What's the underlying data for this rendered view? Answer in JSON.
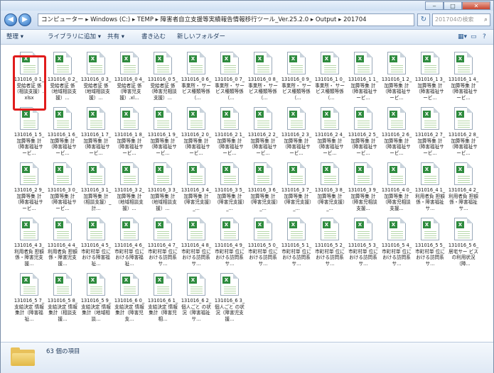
{
  "address": {
    "path": "コンピューター ▸ Windows (C:) ▸ TEMP ▸ 障害者自立支援等実績報告情報移行ツール_Ver.25.2.0 ▸ Output ▸ 201704",
    "search_placeholder": "201704の検索"
  },
  "toolbar": {
    "organize": "整理 ▾",
    "library": "ライブラリに追加 ▾",
    "share": "共有 ▾",
    "burn": "書き込む",
    "new_folder": "新しいフォルダー"
  },
  "files": [
    "131016_0 1_受給者証 係（相談支援）.xlsx",
    "131016_0 2_受給者証 係（地域相談支援）...",
    "131016_0 3_受給者証 係（地域相談支援）...",
    "131016_0 4_受給者証 係（障害児支援）.xl...",
    "131016_0 5_受給者証 係（障害児相談支援）...",
    "131016_0 6_事業所・ サービス種類等係（...",
    "131016_0 7_事業所・ サービス種類等係（...",
    "131016_0 8_事業所・ サービス種類等係（...",
    "131016_0 9_事業所・ サービス種類等係（...",
    "131016_1 0_事業所・ サービス種類等係（...",
    "131016_1 1_加算等集 計（障害福祉サービ...",
    "131016_1 2_加算等集 計（障害福祉サービ...",
    "131016_1 3_加算等集 計（障害福祉サービ...",
    "131016_1 4_加算等集 計（障害福祉サービ...",
    "131016_1 5_加算等集 計（障害福祉サービ...",
    "131016_1 6_加算等集 計（障害福祉サービ...",
    "131016_1 7_加算等集 計（障害福祉サービ...",
    "131016_1 8_加算等集 計（障害福祉サービ...",
    "131016_1 9_加算等集 計（障害福祉サービ...",
    "131016_2 0_加算等集 計（障害福祉サービ...",
    "131016_2 1_加算等集 計（障害福祉サービ...",
    "131016_2 2_加算等集 計（障害福祉サービ...",
    "131016_2 3_加算等集 計（障害福祉サービ...",
    "131016_2 4_加算等集 計（障害福祉サービ...",
    "131016_2 5_加算等集 計（障害福祉サービ...",
    "131016_2 6_加算等集 計（障害福祉サービ...",
    "131016_2 7_加算等集 計（障害福祉サービ...",
    "131016_2 8_加算等集 計（障害福祉サービ...",
    "131016_2 9_加算等集 計（障害福祉サービ...",
    "131016_3 0_加算等集 計（障害福祉サービ...",
    "131016_3 1_加算等集 計（相談支援）_計...",
    "131016_3 2_加算等集 計（地域相談支援）...",
    "131016_3 3_加算等集 計（地域相談支援）...",
    "131016_3 4_加算等集 計（障害児支援）_...",
    "131016_3 5_加算等集 計（障害児支援）_...",
    "131016_3 6_加算等集 計（障害児支援）_...",
    "131016_3 7_加算等集 計（障害児支援）_...",
    "131016_3 8_加算等集 計（障害児支援）_...",
    "131016_3 9_加算等集 計（障害児相談支援...",
    "131016_4 0_加算等集 計（障害児相談支援...",
    "131016_4 1_利用者負 担額係・障害福祉サ...",
    "131016_4 2_利用者負 担額係・障害福祉サ...",
    "131016_4 3_利用者負 担額係・障害児支援...",
    "131016_4 4_利用者負 担額係・障害児支援...",
    "131016_4 5_市町村単 位における障害福祉...",
    "131016_4 6_市町村単 位における障害福祉...",
    "131016_4 7_市町村単 位における訪問系サ...",
    "131016_4 8_市町村単 位における訪問系サ...",
    "131016_4 9_市町村単 位における訪問系サ...",
    "131016_5 0_市町村単 位における訪問系サ...",
    "131016_5 1_市町村単 位における訪問系サ...",
    "131016_5 2_市町村単 位における訪問系サ...",
    "131016_5 3_市町村単 位における訪問系サ...",
    "131016_5 4_市町村単 位における訪問系サ...",
    "131016_5 5_市町村単 位における訪問系サ...",
    "131016_5 6_居宅サー ビスの利用状況（障...",
    "131016_5 7_支給決定 情報集計（障害福祉...",
    "131016_5 8_支給決定 情報集計（相談支援...",
    "131016_5 9_支給決定 情報集計（地域相談...",
    "131016_6 0_支給決定 情報集計（障害児支...",
    "131016_6 1_支給決定 情報集計（障害児相...",
    "131016_6 2_個人ごと の状況（障害福祉サ...",
    "131016_6 3_個人ごと の状況（障害児支援..."
  ],
  "status": {
    "count": "63 個の項目"
  },
  "colors": {
    "highlight": "#e01c1c",
    "excel_green": "#2e8b3e"
  }
}
